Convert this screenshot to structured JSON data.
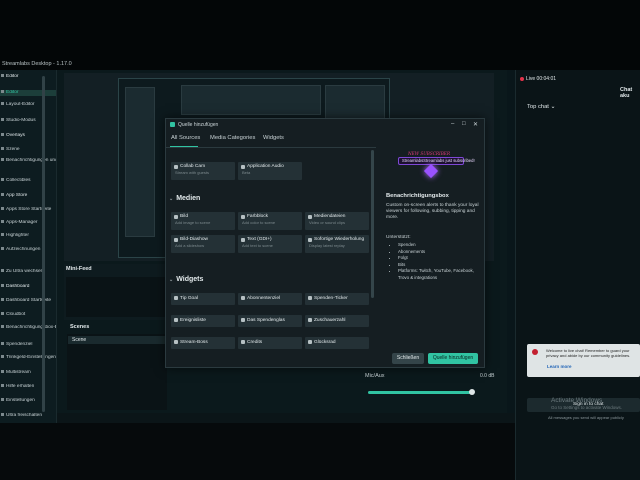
{
  "app": {
    "title": "Streamlabs Desktop - 1.17.0"
  },
  "sidebar": {
    "items": [
      {
        "label": "Editor",
        "head": true
      },
      {
        "label": "Editor",
        "active": true
      },
      {
        "label": "Layout-Editor"
      },
      {
        "label": "Studio-Modus"
      },
      {
        "label": "Overlays",
        "head": true
      },
      {
        "label": "Szene"
      },
      {
        "label": "Benachrichtigungen und Widgets"
      },
      {
        "label": "Collectibles"
      },
      {
        "label": "App Store",
        "head": true
      },
      {
        "label": "Apps Store Startseite"
      },
      {
        "label": "Apps-Manager"
      },
      {
        "label": "Highlighter"
      },
      {
        "label": "Aufzeichnungen"
      },
      {
        "label": "Zu Ultra wechseln"
      },
      {
        "label": "Dashboard",
        "head": true
      },
      {
        "label": "Dashboard Startseite"
      },
      {
        "label": "Cloudbot"
      },
      {
        "label": "Benachrichtigungsbox-Einstellungen"
      },
      {
        "label": "Spendenziel"
      },
      {
        "label": "Trinkgeld-Einstellungen"
      },
      {
        "label": "Multistream"
      },
      {
        "label": "Hilfe erhalten"
      },
      {
        "label": "Einstellungen"
      },
      {
        "label": "Ultra freischalten"
      }
    ]
  },
  "editor": {
    "mini_feed": "Mini-Feed",
    "scenes": "Scenes",
    "scene_name": "Scene",
    "mic_label": "Mic/Aux",
    "mic_db": "0.0 dB",
    "mic_level": 1.0
  },
  "modal": {
    "title": "Quelle hinzufügen",
    "tabs": [
      "All Sources",
      "Media Categories",
      "Widgets"
    ],
    "top_cards": [
      {
        "title": "Collab Cam",
        "sub": "Stream with guests"
      },
      {
        "title": "Application Audio",
        "sub": "Beta"
      }
    ],
    "media_title": "Medien",
    "media_cards": [
      {
        "title": "Bild",
        "sub": "Add image to scene"
      },
      {
        "title": "Farbblock",
        "sub": "Add color to scene"
      },
      {
        "title": "Mediendateien",
        "sub": "Video or sound clips"
      },
      {
        "title": "Bild-Diashow",
        "sub": "Add a slideshow"
      },
      {
        "title": "Text (GDI+)",
        "sub": "Add text to scene"
      },
      {
        "title": "Sofortige Wiederholung",
        "sub": "Display latest replay"
      }
    ],
    "widgets_title": "Widgets",
    "widget_cards": [
      {
        "title": "Tip Goal"
      },
      {
        "title": "Abonnentenziel"
      },
      {
        "title": "Spenden-Ticker"
      },
      {
        "title": "Ereignisliste"
      },
      {
        "title": "Das Spendenglas"
      },
      {
        "title": "Zuschauerzahl"
      },
      {
        "title": "Stream-Boss"
      },
      {
        "title": "Credits"
      },
      {
        "title": "Glücksrad"
      }
    ],
    "detail": {
      "banner_top": "NEW SUBSCRIBER",
      "banner_pill": "StreamlabsStreamlabs just subscribed!",
      "title": "Benachrichtigungsbox",
      "description": "Custom on-screen alerts to thank your loyal viewers for following, subbing, tipping and more.",
      "supported_label": "Unterstützt:",
      "supported": [
        "Spenden",
        "Abonnements",
        "Folgt",
        "Bits",
        "Platforms: Twitch, YouTube, Facebook, Trovo & integrations"
      ]
    },
    "close_label": "Schließen",
    "add_label": "Quelle hinzufügen"
  },
  "chat": {
    "live": "Live 00:04:01",
    "label": "Chat aku",
    "top_chat": "Top chat",
    "notice": "Welcome to live chat! Remember to guard your privacy and abide by our community guidelines.",
    "learn_more": "Learn more",
    "sign_in": "Sign in to chat",
    "footer": "All messages you send will appear publicly",
    "win_activate": "Activate Windows",
    "win_activate_sub": "Go to Settings to activate Windows."
  },
  "colors": {
    "accent": "#31c3a2",
    "live": "#e3334a"
  }
}
